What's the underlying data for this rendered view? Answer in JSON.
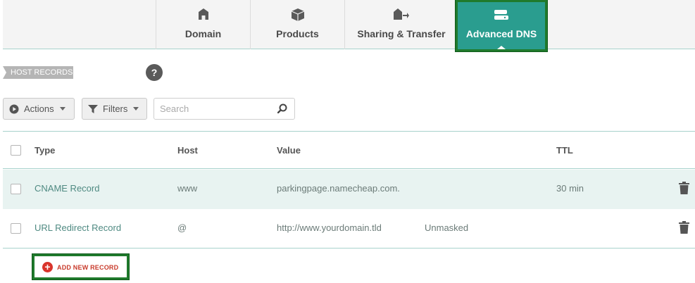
{
  "tabs": [
    {
      "label": "Domain",
      "icon": "home-icon"
    },
    {
      "label": "Products",
      "icon": "box-icon"
    },
    {
      "label": "Sharing & Transfer",
      "icon": "house-transfer-icon"
    },
    {
      "label": "Advanced DNS",
      "icon": "server-icon",
      "active": true
    }
  ],
  "section": {
    "title": "HOST RECORDS",
    "help": "?"
  },
  "toolbar": {
    "actions_label": "Actions",
    "filters_label": "Filters",
    "search_placeholder": "Search"
  },
  "table": {
    "columns": [
      "Type",
      "Host",
      "Value",
      "TTL"
    ],
    "rows": [
      {
        "type": "CNAME Record",
        "host": "www",
        "value": "parkingpage.namecheap.com.",
        "extra": "",
        "ttl": "30 min"
      },
      {
        "type": "URL Redirect Record",
        "host": "@",
        "value": "http://www.yourdomain.tld",
        "extra": "Unmasked",
        "ttl": ""
      }
    ]
  },
  "add_record": {
    "label": "ADD NEW RECORD"
  },
  "colors": {
    "accent": "#2a9d8f",
    "highlight_border": "#1f7a2c",
    "danger": "#d9342b",
    "row_highlight": "#e8f3f1"
  }
}
